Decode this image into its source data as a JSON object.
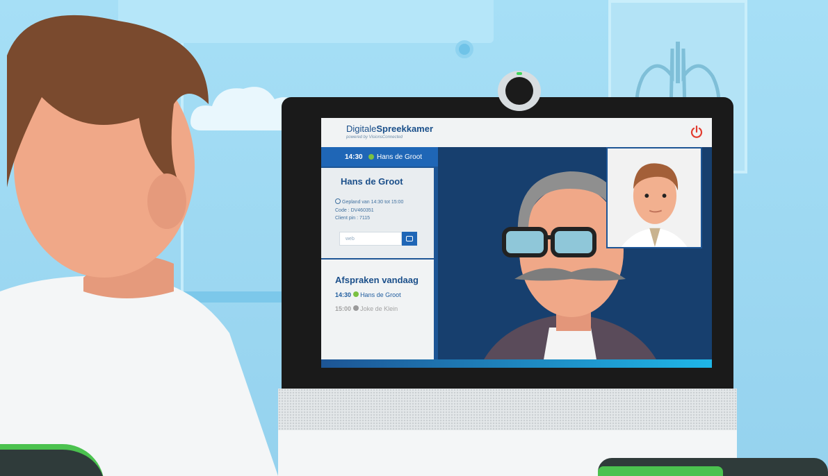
{
  "app": {
    "brand_prefix": "Digitale",
    "brand_bold": "Spreekkamer",
    "brand_sub": "powered by VisionsConnected",
    "power_icon": "power-icon"
  },
  "active_appointment": {
    "time": "14:30",
    "name": "Hans de Groot",
    "status_color": "#7bc142"
  },
  "detail": {
    "title": "Hans de Groot",
    "schedule": "Gepland van 14:30 tot 15:00",
    "code": "Code : DV460351",
    "pin": "Client pin : 7115",
    "web_placeholder": "web"
  },
  "today": {
    "title": "Afspraken vandaag",
    "items": [
      {
        "time": "14:30",
        "name": "Hans de Groot",
        "status_color": "#7bc142"
      },
      {
        "time": "15:00",
        "name": "Joke de Klein",
        "status_color": "#9a9a9a"
      }
    ]
  },
  "colors": {
    "accent": "#1f66b6",
    "panel": "#1d5595",
    "background": "#a6dff6"
  }
}
